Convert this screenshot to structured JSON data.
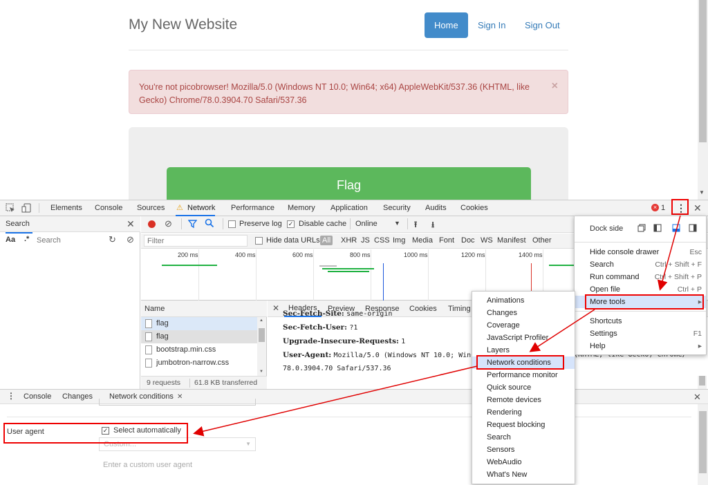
{
  "site": {
    "title": "My New Website",
    "nav": [
      "Home",
      "Sign In",
      "Sign Out"
    ],
    "alert_text": "You're not picobrowser! Mozilla/5.0 (Windows NT 10.0; Win64; x64) AppleWebKit/537.36 (KHTML, like Gecko) Chrome/78.0.3904.70 Safari/537.36",
    "alert_close": "×",
    "flag_button": "Flag"
  },
  "devtools": {
    "tabs": [
      "Elements",
      "Console",
      "Sources",
      "Network",
      "Performance",
      "Memory",
      "Application",
      "Security",
      "Audits",
      "Cookies"
    ],
    "active_tab": "Network",
    "error_count": "1",
    "left_pane": {
      "title": "Search",
      "case_label": "Aa",
      "regex_label": ".*",
      "search_placeholder": "Search"
    },
    "toolbar": {
      "preserve_log": "Preserve log",
      "disable_cache": "Disable cache",
      "throttle": "Online"
    },
    "filter_bar": {
      "placeholder": "Filter",
      "hide_data_urls": "Hide data URLs",
      "types": [
        "All",
        "XHR",
        "JS",
        "CSS",
        "Img",
        "Media",
        "Font",
        "Doc",
        "WS",
        "Manifest",
        "Other"
      ]
    },
    "timeline_ticks": [
      "200 ms",
      "400 ms",
      "600 ms",
      "800 ms",
      "1000 ms",
      "1200 ms",
      "1400 ms"
    ],
    "requests": {
      "header": "Name",
      "rows": [
        "flag",
        "flag",
        "bootstrap.min.css",
        "jumbotron-narrow.css"
      ],
      "status": "9 requests",
      "transferred": "61.8 KB transferred"
    },
    "detail_tabs": [
      "Headers",
      "Preview",
      "Response",
      "Cookies",
      "Timing"
    ],
    "headers": {
      "line1_key": "Sec-Fetch-Site:",
      "line1_val": "same-origin",
      "line2_key": "Sec-Fetch-User:",
      "line2_val": "?1",
      "line3_key": "Upgrade-Insecure-Requests:",
      "line3_val": "1",
      "line4_key": "User-Agent:",
      "line4_val_a": "Mozilla/5.0 (Windows NT 10.0; Win6",
      "line4_val_b": "5 (KHTML, like Gecko) Chrome/",
      "line5_val": "78.0.3904.70 Safari/537.36"
    },
    "drawer": {
      "tabs": [
        "Console",
        "Changes",
        "Network conditions"
      ],
      "user_agent_label": "User agent",
      "select_auto": "Select automatically",
      "custom_select": "Custom...",
      "custom_placeholder": "Enter a custom user agent"
    }
  },
  "main_menu": {
    "dock_side": "Dock side",
    "items": [
      {
        "label": "Hide console drawer",
        "shortcut": "Esc"
      },
      {
        "label": "Search",
        "shortcut": "Ctrl + Shift + F"
      },
      {
        "label": "Run command",
        "shortcut": "Ctrl + Shift + P"
      },
      {
        "label": "Open file",
        "shortcut": "Ctrl + P"
      },
      {
        "label": "More tools",
        "shortcut": "▸"
      },
      {
        "label": "Shortcuts",
        "shortcut": ""
      },
      {
        "label": "Settings",
        "shortcut": "F1"
      },
      {
        "label": "Help",
        "shortcut": "▸"
      }
    ]
  },
  "more_tools_menu": {
    "items": [
      "Animations",
      "Changes",
      "Coverage",
      "JavaScript Profiler",
      "Layers",
      "Network conditions",
      "Performance monitor",
      "Quick source",
      "Remote devices",
      "Rendering",
      "Request blocking",
      "Search",
      "Sensors",
      "WebAudio",
      "What's New"
    ]
  },
  "colors": {
    "accent": "#1a73e8",
    "annotation_red": "#e00000",
    "flag_green": "#5cb85c",
    "alert_bg": "#f2dede"
  }
}
